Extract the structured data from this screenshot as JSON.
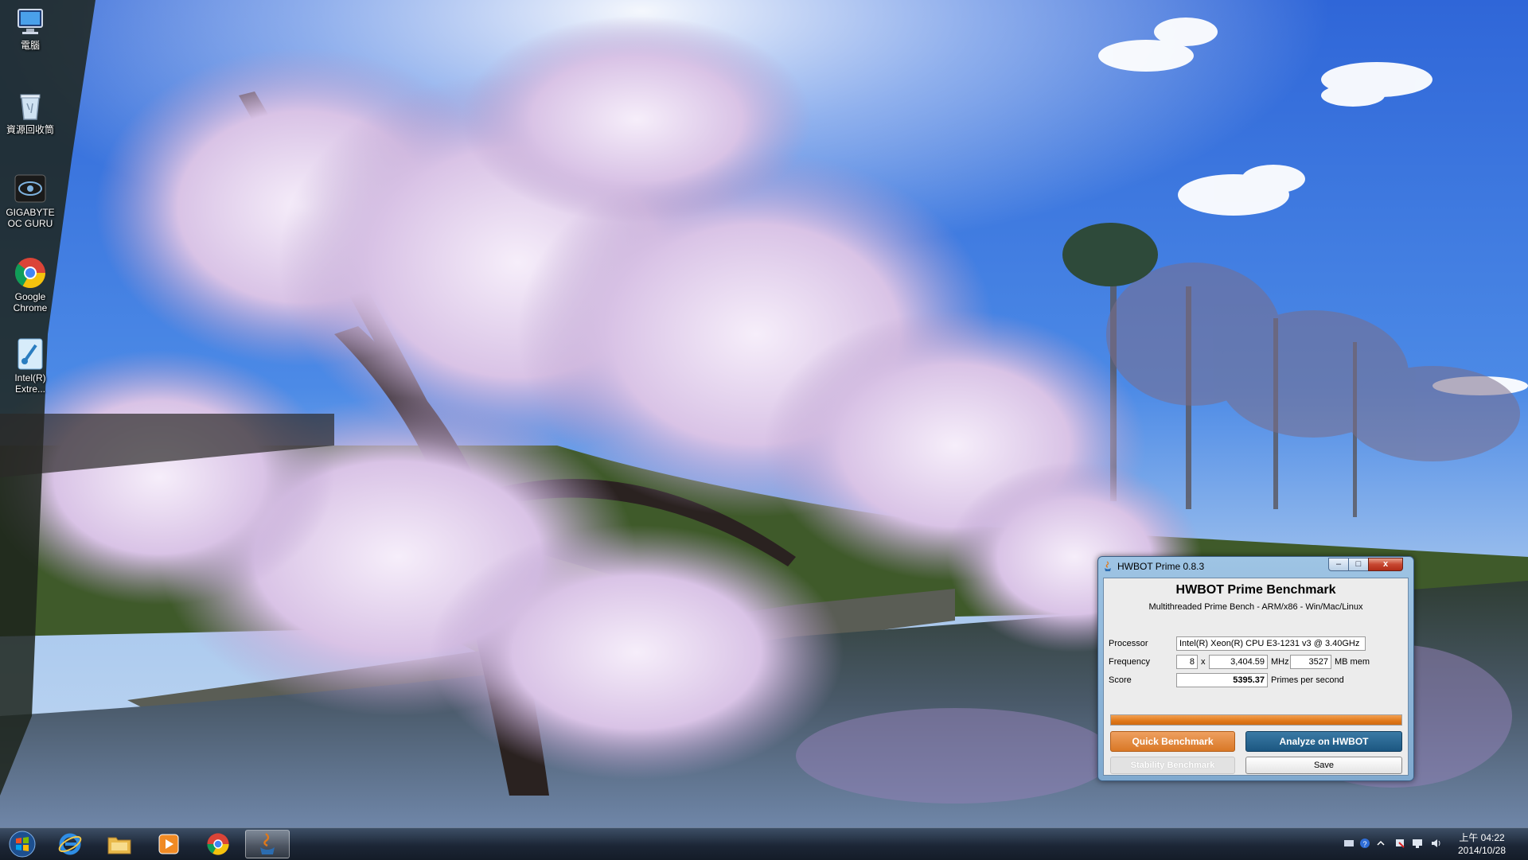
{
  "desktop": {
    "icons": [
      {
        "label": "電腦",
        "icon": "computer-icon"
      },
      {
        "label": "資源回收筒",
        "icon": "recycle-bin-icon"
      },
      {
        "label": "GIGABYTE OC GURU",
        "icon": "gigabyte-oc-guru-icon"
      },
      {
        "label": "Google Chrome",
        "icon": "chrome-icon"
      },
      {
        "label": "Intel(R) Extre...",
        "icon": "intel-xtu-icon"
      }
    ]
  },
  "window": {
    "title": "HWBOT Prime 0.8.3",
    "controls": {
      "minimize": "–",
      "maximize": "□",
      "close": "x"
    },
    "app_title": "HWBOT Prime Benchmark",
    "subtitle": "Multithreaded Prime Bench - ARM/x86 - Win/Mac/Linux",
    "processor": {
      "label": "Processor",
      "value": "Intel(R) Xeon(R) CPU E3-1231 v3 @ 3.40GHz"
    },
    "frequency": {
      "label": "Frequency",
      "threads": "8",
      "times": "x",
      "mhz": "3,404.59",
      "mhz_unit": "MHz",
      "mem": "3527",
      "mem_unit": "MB mem"
    },
    "score": {
      "label": "Score",
      "value": "5395.37",
      "unit": "Primes per second"
    },
    "progress_percent": 100,
    "buttons": {
      "quick_benchmark": "Quick Benchmark",
      "analyze": "Analyze on HWBOT",
      "stability_benchmark": "Stability Benchmark",
      "save": "Save"
    }
  },
  "taskbar": {
    "pinned": [
      {
        "name": "start-orb-icon"
      },
      {
        "name": "internet-explorer-icon"
      },
      {
        "name": "file-explorer-icon"
      },
      {
        "name": "media-player-icon"
      },
      {
        "name": "chrome-icon"
      },
      {
        "name": "java-app-icon",
        "active": true
      }
    ],
    "clock": {
      "time": "上午 04:22",
      "date": "2014/10/28"
    }
  },
  "colors": {
    "accent_orange": "#e07819",
    "accent_blue": "#1c5781"
  }
}
